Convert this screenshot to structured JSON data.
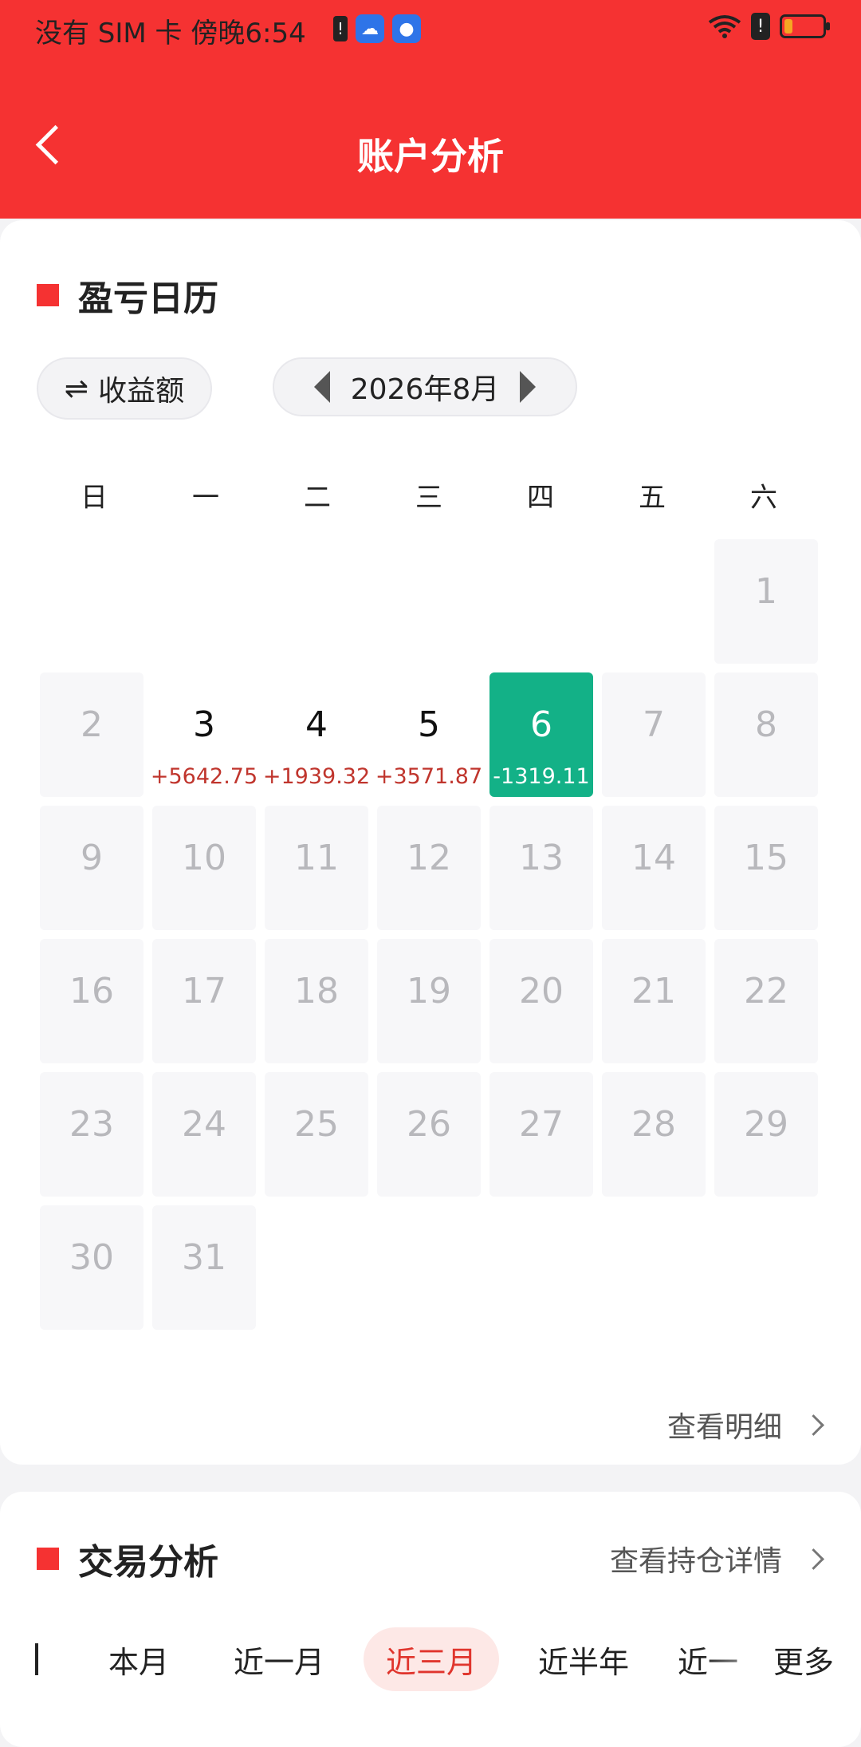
{
  "status_bar": {
    "left_text": "没有 SIM 卡 傍晚6:54"
  },
  "header": {
    "title": "账户分析"
  },
  "calendar_section": {
    "title": "盈亏日历",
    "toggle_label": "收益额",
    "month_label": "2026年8月",
    "weekdays": [
      "日",
      "一",
      "二",
      "三",
      "四",
      "五",
      "六"
    ],
    "days": [
      {
        "day": "1",
        "value": "",
        "state": "inactive"
      },
      {
        "day": "2",
        "value": "",
        "state": "inactive"
      },
      {
        "day": "3",
        "value": "+5642.75",
        "state": "active"
      },
      {
        "day": "4",
        "value": "+1939.32",
        "state": "active"
      },
      {
        "day": "5",
        "value": "+3571.87",
        "state": "active"
      },
      {
        "day": "6",
        "value": "-1319.11",
        "state": "today"
      },
      {
        "day": "7",
        "value": "",
        "state": "inactive"
      },
      {
        "day": "8",
        "value": "",
        "state": "inactive"
      },
      {
        "day": "9",
        "value": "",
        "state": "inactive"
      },
      {
        "day": "10",
        "value": "",
        "state": "inactive"
      },
      {
        "day": "11",
        "value": "",
        "state": "inactive"
      },
      {
        "day": "12",
        "value": "",
        "state": "inactive"
      },
      {
        "day": "13",
        "value": "",
        "state": "inactive"
      },
      {
        "day": "14",
        "value": "",
        "state": "inactive"
      },
      {
        "day": "15",
        "value": "",
        "state": "inactive"
      },
      {
        "day": "16",
        "value": "",
        "state": "inactive"
      },
      {
        "day": "17",
        "value": "",
        "state": "inactive"
      },
      {
        "day": "18",
        "value": "",
        "state": "inactive"
      },
      {
        "day": "19",
        "value": "",
        "state": "inactive"
      },
      {
        "day": "20",
        "value": "",
        "state": "inactive"
      },
      {
        "day": "21",
        "value": "",
        "state": "inactive"
      },
      {
        "day": "22",
        "value": "",
        "state": "inactive"
      },
      {
        "day": "23",
        "value": "",
        "state": "inactive"
      },
      {
        "day": "24",
        "value": "",
        "state": "inactive"
      },
      {
        "day": "25",
        "value": "",
        "state": "inactive"
      },
      {
        "day": "26",
        "value": "",
        "state": "inactive"
      },
      {
        "day": "27",
        "value": "",
        "state": "inactive"
      },
      {
        "day": "28",
        "value": "",
        "state": "inactive"
      },
      {
        "day": "29",
        "value": "",
        "state": "inactive"
      },
      {
        "day": "30",
        "value": "",
        "state": "inactive"
      },
      {
        "day": "31",
        "value": "",
        "state": "inactive"
      }
    ],
    "view_detail_label": "查看明细"
  },
  "trade_section": {
    "title": "交易分析",
    "position_detail_label": "查看持仓详情",
    "tabs": [
      "本月",
      "近一月",
      "近三月",
      "近半年",
      "近一",
      "更多"
    ],
    "selected_tab": "近三月"
  },
  "colors": {
    "header_red": "#f53232",
    "profit_red": "#c0352d",
    "today_green": "#13b187"
  }
}
